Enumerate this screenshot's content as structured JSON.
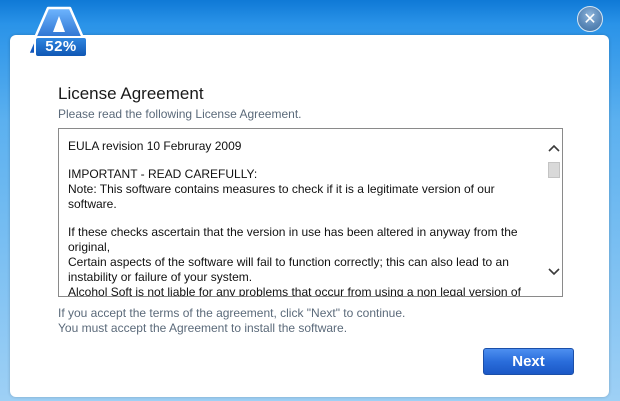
{
  "window": {
    "close_glyph": "✕"
  },
  "logo": {
    "icon": "alcohol-a-logo-icon",
    "progress_label": "52%",
    "progress_value": 52
  },
  "header": {
    "title": "License Agreement",
    "subtitle": "Please read the following License Agreement."
  },
  "eula": {
    "revision": "EULA revision 10 Februray 2009",
    "important_heading": "IMPORTANT - READ CAREFULLY:",
    "note": "Note: This software contains measures to check if it is a legitimate version of our software.",
    "checks_line1": "If these checks ascertain that the version in use has been altered in anyway from the original,",
    "checks_line2": "Certain aspects of the software will fail to function correctly; this can also lead to an instability or failure of your system.",
    "checks_line3": "Alcohol Soft is not liable for any problems that occur from using a non legal version of",
    "scroll_up_icon": "chevron-up-icon",
    "scroll_down_icon": "chevron-down-icon"
  },
  "notice": {
    "line1": "If you accept the terms of the agreement, click \"Next\" to continue.",
    "line2": "You must accept the Agreement to install the software."
  },
  "buttons": {
    "next_label": "Next"
  },
  "colors": {
    "background_top": "#0f79d6",
    "background_bottom": "#9ed0f5",
    "button_blue": "#2a6ddb",
    "subtle_text": "#5b6a7a"
  }
}
